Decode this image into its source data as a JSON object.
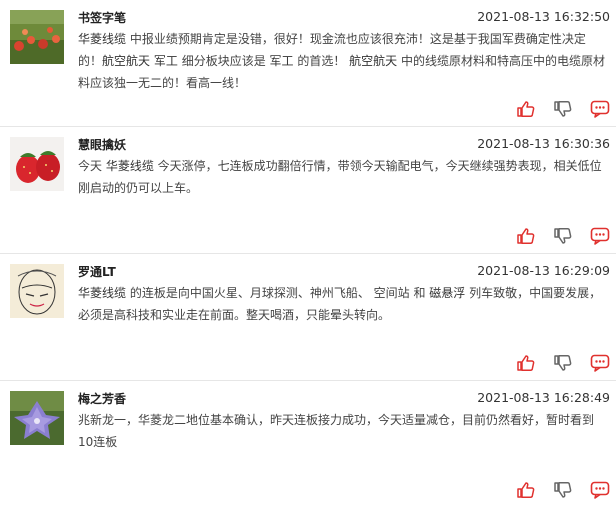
{
  "posts": [
    {
      "author": "书签字笔",
      "time": "2021-08-13 16:32:50",
      "segments": [
        {
          "t": "华菱线缆",
          "kw": true
        },
        {
          "t": " 中报业绩预期肯定是没错，很好！现金流也应该很充沛！这是基于我国军费确定性决定的！",
          "kw": false
        },
        {
          "t": "航空航天",
          "kw": true
        },
        {
          "t": " ",
          "kw": false
        },
        {
          "t": "军工",
          "kw": true
        },
        {
          "t": " 细分板块应该是 ",
          "kw": false
        },
        {
          "t": "军工",
          "kw": true
        },
        {
          "t": " 的首选！ ",
          "kw": false
        },
        {
          "t": "航空航天",
          "kw": true
        },
        {
          "t": " 中的线缆原材料和特高压中的电缆原材料应该独一无二的！看高一线！",
          "kw": false
        }
      ],
      "avatar": "flowers"
    },
    {
      "author": "慧眼擒妖",
      "time": "2021-08-13 16:30:36",
      "segments": [
        {
          "t": "今天 ",
          "kw": false
        },
        {
          "t": "华菱线缆",
          "kw": true
        },
        {
          "t": " 今天涨停，七连板成功翻倍行情，带领今天输配电气，今天继续强势表现，相关低位刚启动的仍可以上车。",
          "kw": false
        }
      ],
      "avatar": "strawberries"
    },
    {
      "author": "罗通LT",
      "time": "2021-08-13 16:29:09",
      "segments": [
        {
          "t": "华菱线缆",
          "kw": true
        },
        {
          "t": " 的连板是向中国火星、月球探测、神州飞船、 空间站 和 ",
          "kw": false
        },
        {
          "t": "磁悬浮",
          "kw": true
        },
        {
          "t": " 列车致敬，中国要发展，必须是高科技和实业走在前面。整天喝酒，只能晕头转向。",
          "kw": false
        }
      ],
      "avatar": "sketch"
    },
    {
      "author": "梅之芳香",
      "time": "2021-08-13 16:28:49",
      "segments": [
        {
          "t": "兆新龙一，华菱龙二地位基本确认，昨天连板接力成功，今天适量减仓，目前仍然看好，暂时看到10连板",
          "kw": false
        }
      ],
      "avatar": "bellflower"
    }
  ],
  "icons": {
    "like": "thumbs-up-icon",
    "dislike": "thumbs-down-icon",
    "comment": "comment-icon"
  },
  "colors": {
    "like": "#e0312e",
    "dislike": "#666666",
    "comment": "#e0312e",
    "divider": "#e6e6e6"
  }
}
